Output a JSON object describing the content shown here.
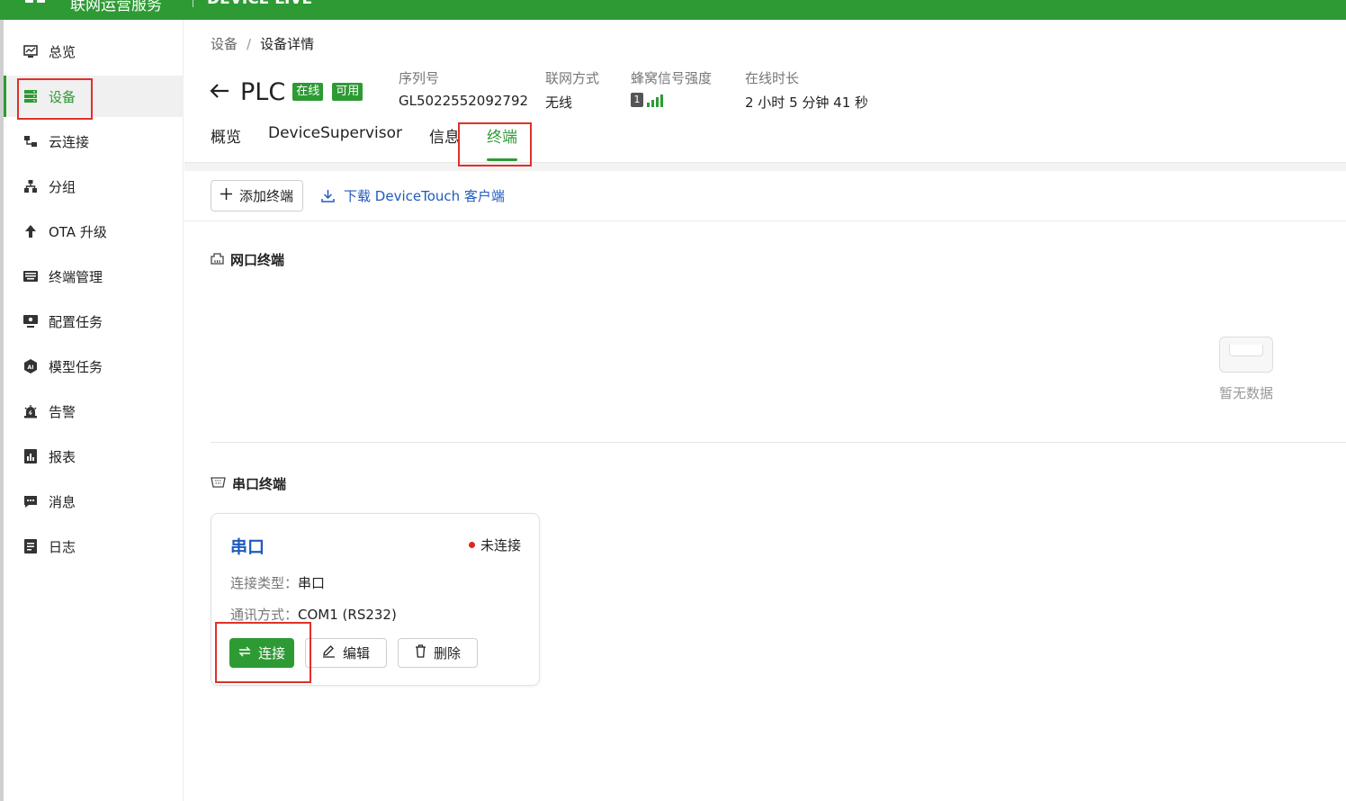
{
  "topbar": {
    "title": "联网运营服务",
    "logo": "DEVICE LIVE"
  },
  "sidebar": {
    "items": [
      {
        "label": "总览",
        "icon": "chart-icon"
      },
      {
        "label": "设备",
        "icon": "device-list-icon",
        "active": true
      },
      {
        "label": "云连接",
        "icon": "cloud-connect-icon"
      },
      {
        "label": "分组",
        "icon": "group-tree-icon"
      },
      {
        "label": "OTA 升级",
        "icon": "upload-arrow-icon"
      },
      {
        "label": "终端管理",
        "icon": "keyboard-icon"
      },
      {
        "label": "配置任务",
        "icon": "config-monitor-icon"
      },
      {
        "label": "模型任务",
        "icon": "ai-icon"
      },
      {
        "label": "告警",
        "icon": "alarm-icon"
      },
      {
        "label": "报表",
        "icon": "report-icon"
      },
      {
        "label": "消息",
        "icon": "message-icon"
      },
      {
        "label": "日志",
        "icon": "log-icon"
      }
    ]
  },
  "breadcrumb": {
    "root": "设备",
    "current": "设备详情"
  },
  "device": {
    "name": "PLC",
    "tags": [
      "在线",
      "可用"
    ],
    "serial_label": "序列号",
    "serial": "GL5022552092792",
    "network_label": "联网方式",
    "network": "无线",
    "signal_label": "蜂窝信号强度",
    "signal_sim": "1",
    "online_label": "在线时长",
    "online": "2 小时 5 分钟 41 秒"
  },
  "tabs": [
    "概览",
    "DeviceSupervisor",
    "信息",
    "终端"
  ],
  "active_tab": "终端",
  "toolbar": {
    "add_label": "添加终端",
    "download_label": "下载 DeviceTouch 客户端"
  },
  "network_terminal": {
    "title": "网口终端",
    "empty_text": "暂无数据"
  },
  "serial_terminal": {
    "title": "串口终端",
    "card": {
      "name": "串口",
      "status": "未连接",
      "type_label": "连接类型：",
      "type": "串口",
      "comm_label": "通讯方式：",
      "comm": "COM1 (RS232)",
      "connect_label": "连接",
      "edit_label": "编辑",
      "delete_label": "删除"
    }
  },
  "colors": {
    "brand": "#2e9a34",
    "link": "#1f5bbd",
    "highlight": "#e0302a",
    "offline": "#e0261e"
  }
}
